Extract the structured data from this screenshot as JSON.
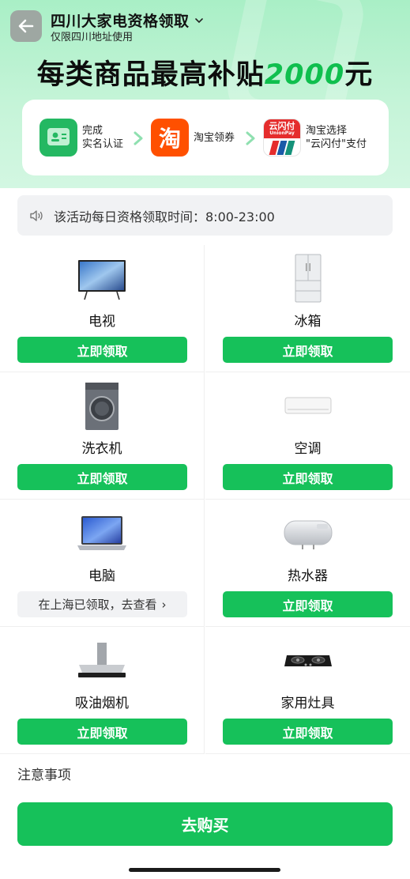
{
  "header": {
    "title": "四川大家电资格领取",
    "subtitle": "仅限四川地址使用",
    "headline_prefix": "每类商品最高补贴",
    "headline_amount": "2000",
    "headline_suffix": "元"
  },
  "steps": [
    {
      "line1": "完成",
      "line2": "实名认证",
      "icon": "id-card-icon"
    },
    {
      "line1": "淘宝领券",
      "icon": "taobao-icon",
      "icon_text": "淘"
    },
    {
      "line1": "淘宝选择",
      "line2": "\"云闪付\"支付",
      "icon": "unionpay-icon",
      "icon_text": "云闪付",
      "icon_sub": "UnionPay"
    }
  ],
  "notice": {
    "text": "该活动每日资格领取时间：8:00-23:00",
    "icon": "speaker-icon"
  },
  "products": [
    {
      "name": "电视",
      "action": "立即领取",
      "status": "available",
      "icon": "tv-icon"
    },
    {
      "name": "冰箱",
      "action": "立即领取",
      "status": "available",
      "icon": "fridge-icon"
    },
    {
      "name": "洗衣机",
      "action": "立即领取",
      "status": "available",
      "icon": "washer-icon"
    },
    {
      "name": "空调",
      "action": "立即领取",
      "status": "available",
      "icon": "ac-icon"
    },
    {
      "name": "电脑",
      "action": "在上海已领取，去查看",
      "status": "claimed",
      "icon": "laptop-icon"
    },
    {
      "name": "热水器",
      "action": "立即领取",
      "status": "available",
      "icon": "water-heater-icon"
    },
    {
      "name": "吸油烟机",
      "action": "立即领取",
      "status": "available",
      "icon": "range-hood-icon"
    },
    {
      "name": "家用灶具",
      "action": "立即领取",
      "status": "available",
      "icon": "gas-stove-icon"
    }
  ],
  "notes_label": "注意事项",
  "buy_label": "去购买",
  "colors": {
    "accent": "#16c15a",
    "hero": "#a9efc6",
    "taobao": "#ff5000",
    "unionpay": "#e52d2d"
  }
}
